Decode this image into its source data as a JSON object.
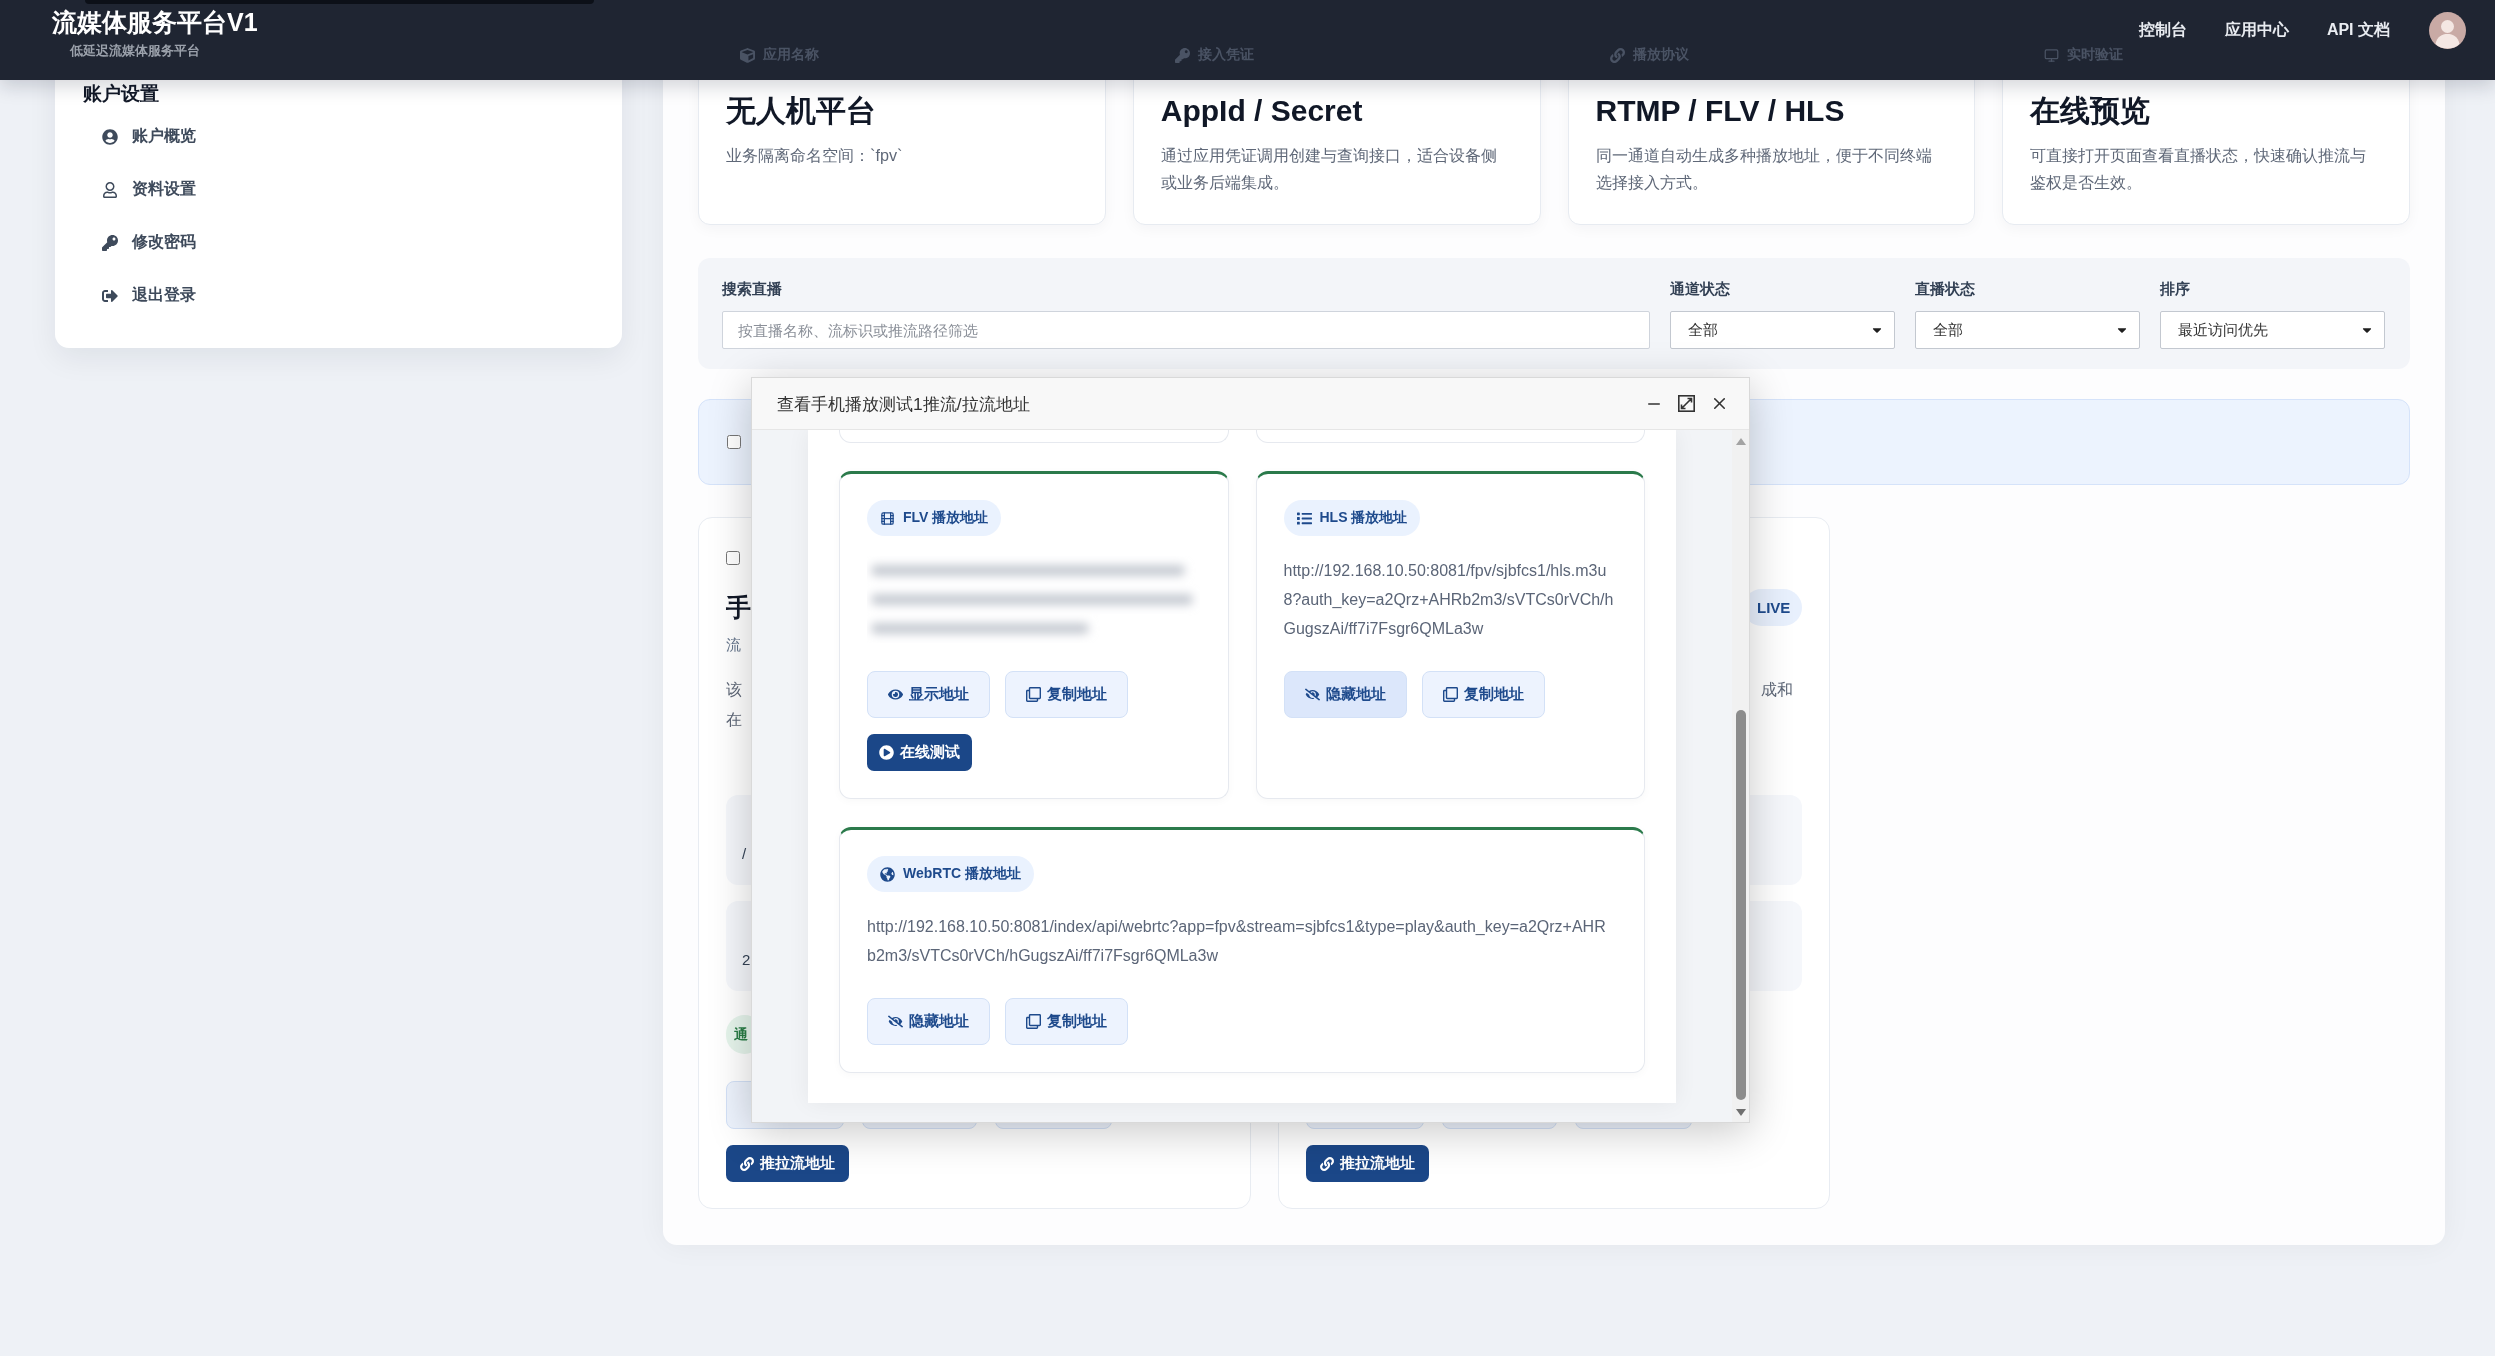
{
  "header": {
    "title": "流媒体服务平台V1",
    "subtitle": "低延迟流媒体服务平台",
    "nav": [
      "控制台",
      "应用中心",
      "API 文档"
    ]
  },
  "sidebar": {
    "title": "账户设置",
    "items": [
      "账户概览",
      "资料设置",
      "修改密码",
      "退出登录"
    ]
  },
  "summary_cards": [
    {
      "label": "应用名称",
      "title": "无人机平台",
      "description": "业务隔离命名空间：`fpv`"
    },
    {
      "label": "接入凭证",
      "title": "AppId / Secret",
      "description": "通过应用凭证调用创建与查询接口，适合设备侧或业务后端集成。"
    },
    {
      "label": "播放协议",
      "title": "RTMP / FLV / HLS",
      "description": "同一通道自动生成多种播放地址，便于不同终端选择接入方式。"
    },
    {
      "label": "实时验证",
      "title": "在线预览",
      "description": "可直接打开页面查看直播状态，快速确认推流与鉴权是否生效。"
    }
  ],
  "filters": {
    "search": {
      "label": "搜索直播",
      "placeholder": "按直播名称、流标识或推流路径筛选"
    },
    "selects": [
      {
        "label": "通道状态",
        "value": "全部"
      },
      {
        "label": "直播状态",
        "value": "全部"
      },
      {
        "label": "排序",
        "value": "最近访问优先"
      }
    ]
  },
  "bulk_bar": {
    "checked": false
  },
  "stream_cards": [
    {
      "checked": false,
      "title": "手",
      "subtitle": "流",
      "description_lines": [
        "该",
        "在"
      ],
      "info_values": [
        "/",
        "2"
      ],
      "status_badge": "通",
      "action_button": "推拉流地址"
    },
    {
      "live_badge": "LIVE",
      "description_line_ends": [
        "成和"
      ],
      "action_button": "推拉流地址"
    }
  ],
  "dialog": {
    "title": "查看手机播放测试1推流/拉流地址",
    "addresses": [
      {
        "label": "FLV 播放地址",
        "revealed": false,
        "buttons": [
          {
            "kind": "toggle",
            "label": "显示地址",
            "highlighted": false
          },
          {
            "kind": "copy",
            "label": "复制地址",
            "highlighted": false
          },
          {
            "kind": "test",
            "label": "在线测试",
            "highlighted": false
          }
        ]
      },
      {
        "label": "HLS 播放地址",
        "revealed": true,
        "url": "http://192.168.10.50:8081/fpv/sjbfcs1/hls.m3u8?auth_key=a2Qrz+AHRb2m3/sVTCs0rVCh/hGugszAi/ff7i7Fsgr6QMLa3w",
        "buttons": [
          {
            "kind": "toggle",
            "label": "隐藏地址",
            "highlighted": true
          },
          {
            "kind": "copy",
            "label": "复制地址",
            "highlighted": false
          }
        ]
      },
      {
        "label": "WebRTC 播放地址",
        "revealed": true,
        "url": "http://192.168.10.50:8081/index/api/webrtc?app=fpv&stream=sjbfcs1&type=play&auth_key=a2Qrz+AHRb2m3/sVTCs0rVCh/hGugszAi/ff7i7Fsgr6QMLa3w",
        "buttons": [
          {
            "kind": "toggle",
            "label": "隐藏地址",
            "highlighted": false
          },
          {
            "kind": "copy",
            "label": "复制地址",
            "highlighted": false
          }
        ]
      }
    ]
  }
}
